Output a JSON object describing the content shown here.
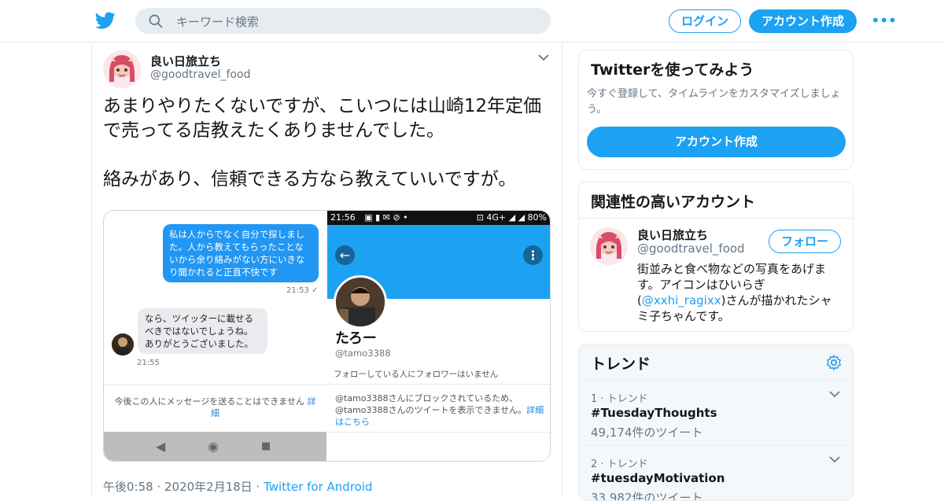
{
  "header": {
    "search_placeholder": "キーワード検索",
    "login_label": "ログイン",
    "signup_label": "アカウント作成",
    "more_glyph": "•••"
  },
  "tweet": {
    "author_name": "良い日旅立ち",
    "author_handle": "@goodtravel_food",
    "text": "あまりやりたくないですが、こいつには山崎12年定価で売ってる店教えたくありませんでした。\n\n絡みがあり、信頼できる方なら教えていいですが。",
    "timestamp": "午後0:58 · 2020年2月18日 · ",
    "source": "Twitter for Android",
    "media": {
      "chat": {
        "outgoing": "私は人からでなく自分で探しました。人から教えてもらったことないから余り絡みがない方にいきなり聞かれると正直不快です",
        "outgoing_time": "21:53 ✓",
        "incoming": "なら、ツイッターに載せるべきではないでしょうね。ありがとうございました。",
        "incoming_time": "21:55",
        "note": "今後この人にメッセージを送ることはできません ",
        "note_link": "詳細",
        "nav_back": "◀",
        "nav_home": "◉",
        "nav_recent": "■"
      },
      "profile": {
        "status_time": "21:56",
        "status_icons": "▣ ▮ ✉ ⊘ •",
        "status_right": "⊡ 4G+ ◢ ◢ 80%",
        "back_glyph": "←",
        "menu_glyph": "⋮",
        "name": "たろー",
        "handle": "@tamo3388",
        "follow_info": "フォローしている人にフォロワーはいません",
        "blocked_text": "@tamo3388さんにブロックされているため、@tamo3388さんのツイートを表示できません。",
        "blocked_link": "詳細はこちら"
      }
    }
  },
  "signup_card": {
    "title": "Twitterを使ってみよう",
    "subtitle": "今すぐ登録して、タイムラインをカスタマイズしましょう。",
    "button": "アカウント作成"
  },
  "related_card": {
    "title": "関連性の高いアカウント",
    "name": "良い日旅立ち",
    "handle": "@goodtravel_food",
    "follow_label": "フォロー",
    "bio_part1": "街並みと食べ物などの写真をあげます。アイコンはひいらぎ(",
    "bio_link": "@xxhi_ragixx",
    "bio_part2": ")さんが描かれたシャミ子ちゃんです。"
  },
  "trends_card": {
    "title": "トレンド",
    "items": [
      {
        "meta": "1 · トレンド",
        "tag": "#TuesdayThoughts",
        "count": "49,174件のツイート"
      },
      {
        "meta": "2 · トレンド",
        "tag": "#tuesdayMotivation",
        "count": "33,982件のツイート"
      }
    ]
  },
  "colors": {
    "brand": "#1da1f2",
    "text": "#14171a",
    "muted": "#657786"
  },
  "icons": [
    "twitter-bird-icon",
    "search-icon",
    "more-icon",
    "chevron-down-icon",
    "gear-icon"
  ]
}
